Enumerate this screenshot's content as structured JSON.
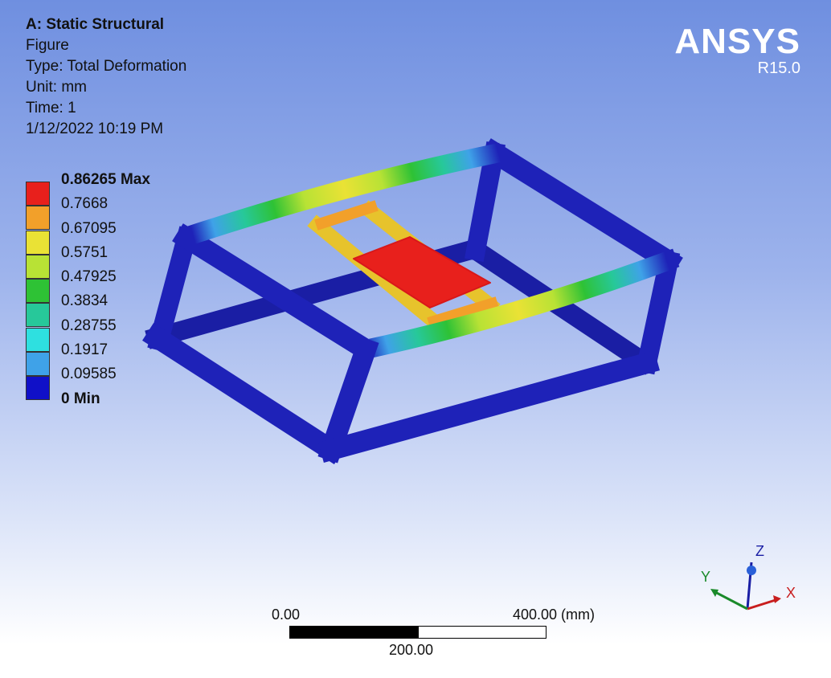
{
  "info": {
    "title": "A: Static Structural",
    "name": "Figure",
    "type": "Type: Total Deformation",
    "unit": "Unit: mm",
    "time": "Time: 1",
    "date": "1/12/2022 10:19 PM"
  },
  "brand": {
    "name": "ANSYS",
    "version": "R15.0"
  },
  "legend": {
    "labels": [
      "0.86265 Max",
      "0.7668",
      "0.67095",
      "0.5751",
      "0.47925",
      "0.3834",
      "0.28755",
      "0.1917",
      "0.09585",
      "0 Min"
    ],
    "colors": [
      "#e8201c",
      "#f2a02a",
      "#eae235",
      "#b8e235",
      "#2ec235",
      "#27c89a",
      "#2ee0e0",
      "#3fa2e8",
      "#1010c8"
    ]
  },
  "scale": {
    "start": "0.00",
    "end": "400.00 (mm)",
    "mid": "200.00"
  },
  "triad": {
    "x": "X",
    "y": "Y",
    "z": "Z"
  },
  "colors": {
    "frame": "#1e22b8",
    "max": "#e8201c",
    "background_top": "#6f8fe0"
  }
}
